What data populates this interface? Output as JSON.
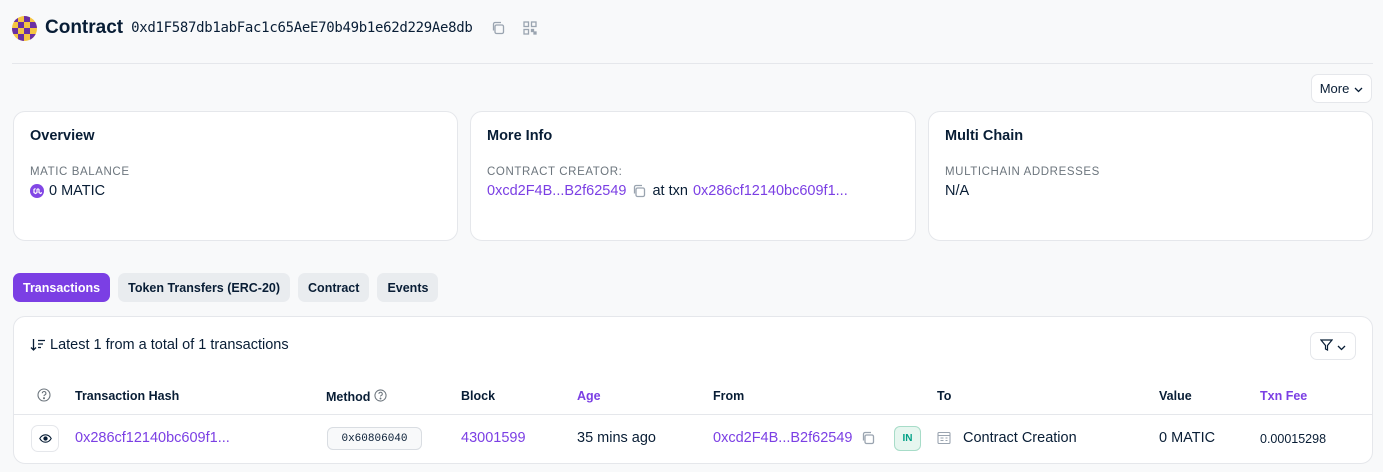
{
  "header": {
    "title": "Contract",
    "address": "0xd1F587db1abFac1c65AeE70b49b1e62d229Ae8db"
  },
  "more_button": {
    "label": "More"
  },
  "overview": {
    "title": "Overview",
    "balance_label": "MATIC BALANCE",
    "balance_value": "0 MATIC"
  },
  "more_info": {
    "title": "More Info",
    "creator_label": "CONTRACT CREATOR:",
    "creator_address": "0xcd2F4B...B2f62549",
    "at_txn_text": "at txn",
    "creation_txn": "0x286cf12140bc609f1..."
  },
  "multi_chain": {
    "title": "Multi Chain",
    "addresses_label": "MULTICHAIN ADDRESSES",
    "addresses_value": "N/A"
  },
  "tabs": [
    {
      "label": "Transactions",
      "active": true
    },
    {
      "label": "Token Transfers (ERC-20)",
      "active": false
    },
    {
      "label": "Contract",
      "active": false
    },
    {
      "label": "Events",
      "active": false
    }
  ],
  "transactions": {
    "summary": "Latest 1 from a total of 1 transactions",
    "columns": {
      "hash": "Transaction Hash",
      "method": "Method",
      "block": "Block",
      "age": "Age",
      "from": "From",
      "to": "To",
      "value": "Value",
      "fee": "Txn Fee"
    },
    "rows": [
      {
        "hash": "0x286cf12140bc609f1...",
        "method": "0x60806040",
        "block": "43001599",
        "age": "35 mins ago",
        "from": "0xcd2F4B...B2f62549",
        "direction": "IN",
        "to": "Contract Creation",
        "value": "0 MATIC",
        "fee": "0.00015298"
      }
    ]
  },
  "colors": {
    "accent": "#7b3fe4",
    "text": "#081d35",
    "muted": "#6c757d",
    "in_badge": "#00a186"
  }
}
